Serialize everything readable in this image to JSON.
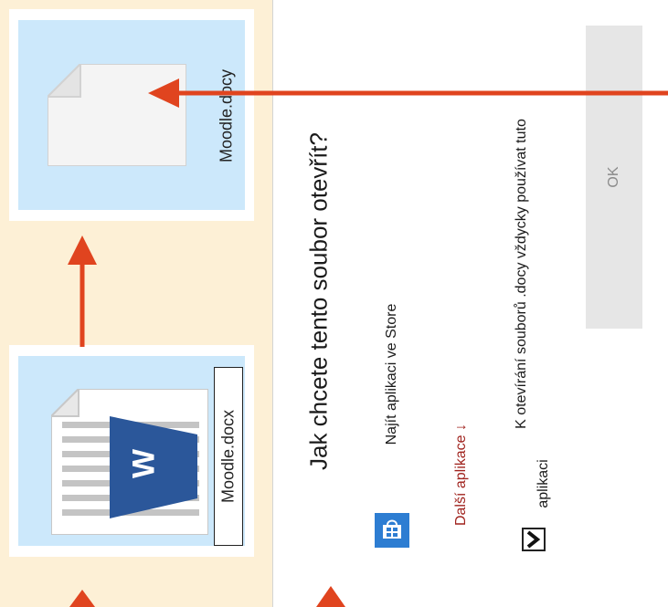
{
  "files": {
    "target_name": "Moodle.docy",
    "source_name": "Moodle.docx",
    "word_icon_letter": "W"
  },
  "dialog": {
    "title": "Jak chcete tento soubor otevřít?",
    "store_option": "Najít aplikaci ve Store",
    "more_apps": "Další aplikace ↓",
    "always_use_line1": "K otevírání souborů .docy vždycky používat tuto",
    "always_use_line2": "aplikaci",
    "always_use_checked": true,
    "ok_label": "OK"
  },
  "colors": {
    "background": "#fdf0d6",
    "tile": "#cce8fb",
    "arrow": "#e0441f",
    "word_blue": "#2b579a",
    "store_blue": "#2d7dd2",
    "link_red": "#a0231e",
    "ok_disabled": "#e6e6e6"
  }
}
